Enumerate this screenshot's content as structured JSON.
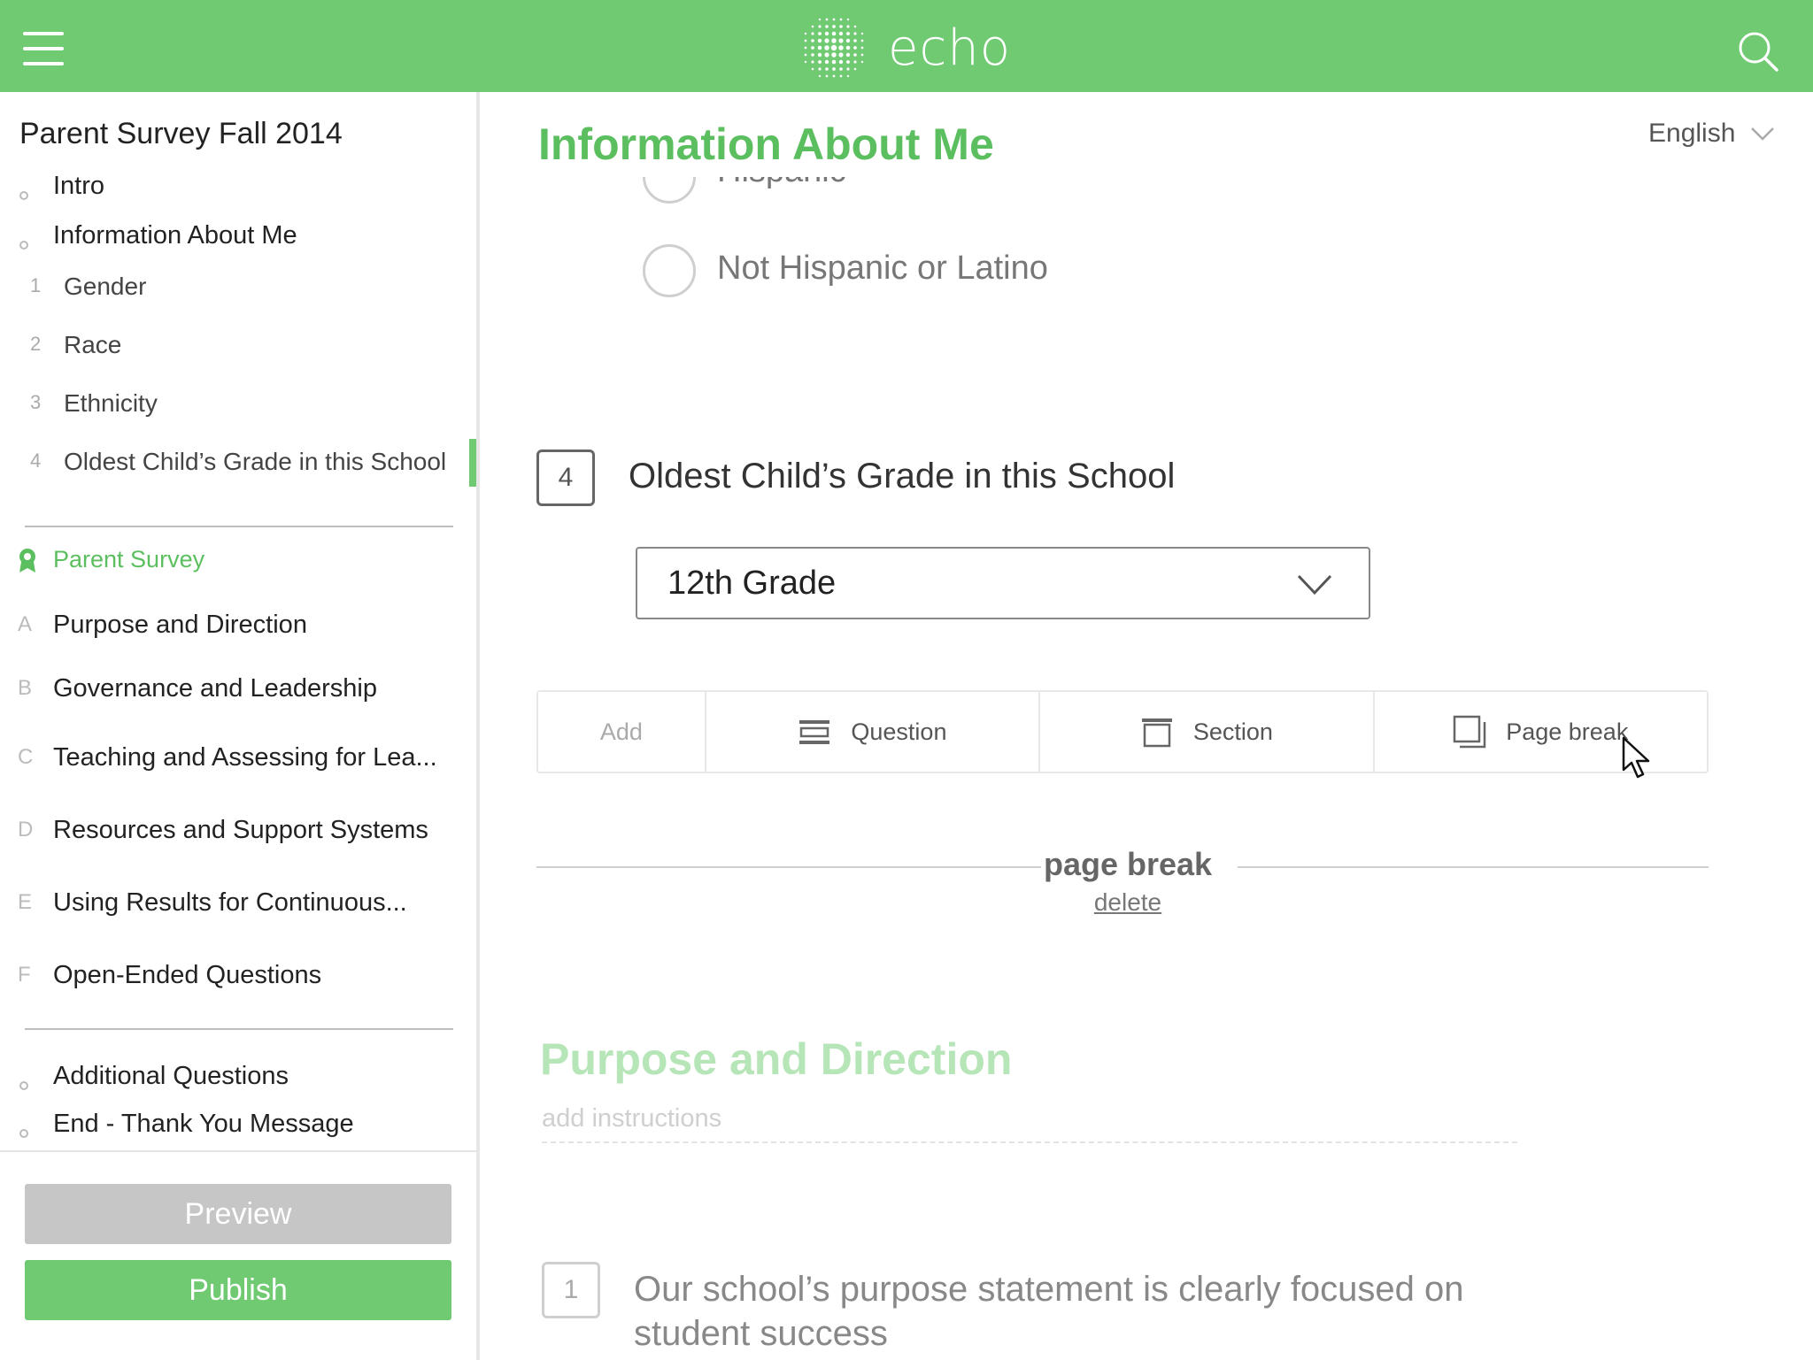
{
  "app": {
    "logo_text": "echo",
    "brand_color": "#6fca72"
  },
  "topbar": {
    "menu_icon": "hamburger-menu-icon",
    "search_icon": "search-icon"
  },
  "sidebar": {
    "survey_title": "Parent Survey Fall 2014",
    "sections": [
      {
        "label": "Intro"
      },
      {
        "label": "Information About Me"
      }
    ],
    "questions": [
      {
        "num": "1",
        "label": "Gender"
      },
      {
        "num": "2",
        "label": "Race"
      },
      {
        "num": "3",
        "label": "Ethnicity"
      },
      {
        "num": "4",
        "label": "Oldest Child’s Grade in this School"
      }
    ],
    "group_label": "Parent Survey",
    "lettered": [
      {
        "letter": "A",
        "label": "Purpose and Direction"
      },
      {
        "letter": "B",
        "label": "Governance and Leadership"
      },
      {
        "letter": "C",
        "label": "Teaching and Assessing for Lea..."
      },
      {
        "letter": "D",
        "label": "Resources and Support Systems"
      },
      {
        "letter": "E",
        "label": "Using Results for Continuous..."
      },
      {
        "letter": "F",
        "label": "Open-Ended Questions"
      }
    ],
    "extra": [
      {
        "label": "Additional Questions"
      },
      {
        "label": "End - Thank You Message"
      }
    ],
    "preview_label": "Preview",
    "publish_label": "Publish"
  },
  "main": {
    "section_title": "Information About Me",
    "language": "English",
    "radio_partial": "Hispanic",
    "radio_option": "Not Hispanic or Latino",
    "question4": {
      "num": "4",
      "text": "Oldest Child’s Grade in this School",
      "selected": "12th Grade"
    },
    "add_bar": {
      "add_label": "Add",
      "question_label": "Question",
      "section_label": "Section",
      "page_break_label": "Page break"
    },
    "page_break": {
      "title": "page break",
      "delete_label": "delete"
    },
    "section2_title": "Purpose and Direction",
    "add_instructions": "add instructions",
    "question1": {
      "num": "1",
      "text": "Our school’s purpose statement is clearly focused on student success"
    }
  }
}
